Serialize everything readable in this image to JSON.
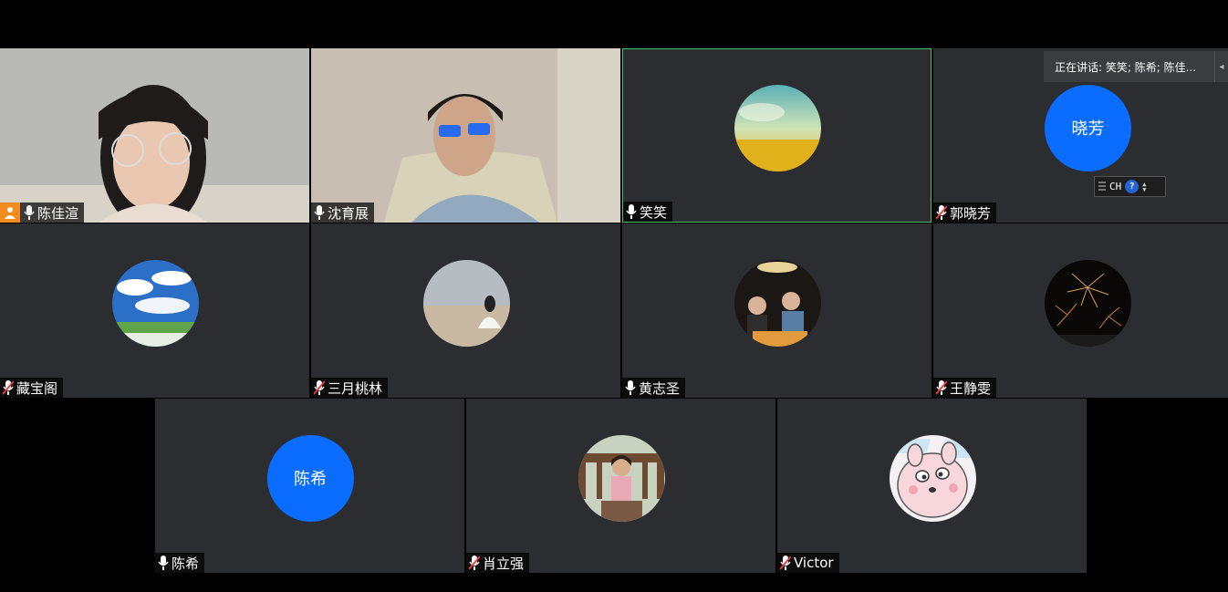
{
  "speaking_bar": {
    "text": "正在讲话: 笑笑; 陈希; 陈佳..."
  },
  "ime_toolbar": {
    "lang": "CH",
    "help": "?"
  },
  "participants": [
    {
      "name": "陈佳渲",
      "avatar_type": "video",
      "host": true,
      "mic": "on"
    },
    {
      "name": "沈育展",
      "avatar_type": "video",
      "host": false,
      "mic": "on"
    },
    {
      "name": "笑笑",
      "avatar_type": "photo",
      "mic": "on",
      "active_speaker": true
    },
    {
      "name": "郭晓芳",
      "avatar_type": "text",
      "avatar_text": "晓芳",
      "mic": "muted"
    },
    {
      "name": "藏宝阁",
      "avatar_type": "photo",
      "mic": "muted"
    },
    {
      "name": "三月桃林",
      "avatar_type": "photo",
      "mic": "muted"
    },
    {
      "name": "黄志圣",
      "avatar_type": "photo",
      "mic": "on"
    },
    {
      "name": "王静雯",
      "avatar_type": "photo",
      "mic": "muted"
    },
    {
      "name": "陈希",
      "avatar_type": "text",
      "avatar_text": "陈希",
      "mic": "on"
    },
    {
      "name": "肖立强",
      "avatar_type": "photo",
      "mic": "muted"
    },
    {
      "name": "Victor",
      "avatar_type": "photo",
      "mic": "muted"
    }
  ],
  "colors": {
    "tile_bg": "#2b2d30",
    "active_border": "#3fc46a",
    "text_avatar_bg": "#0a6dff",
    "host_badge": "#f28c1e",
    "muted_mic": "#e23b3b"
  }
}
